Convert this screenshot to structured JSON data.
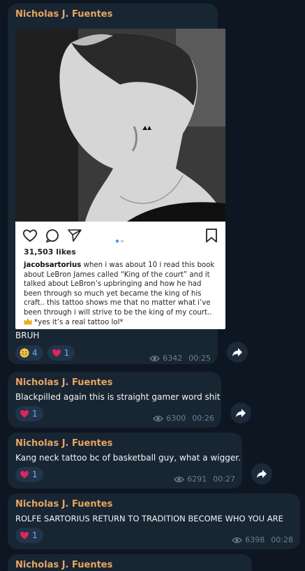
{
  "messages": [
    {
      "sender": "Nicholas J. Fuentes",
      "instagram": {
        "likes": "31,503 likes",
        "caption_user": "jacobsartorius",
        "caption_text": " when i was about 10 i read this book about LeBron James called “King of the court” and it talked about LeBron’s upbringing and how he had been through so much yet became the king of his craft.. this tattoo shows me that no matter what i’ve been through i will strive to be the king of my court..",
        "caption_tail": "*yes it’s a real tattoo lol*"
      },
      "text": "BRUH",
      "reactions": [
        {
          "emoji": "grinning-face",
          "count": "4"
        },
        {
          "emoji": "red-heart",
          "count": "1"
        }
      ],
      "views": "6342",
      "time": "00:25"
    },
    {
      "sender": "Nicholas J. Fuentes",
      "text": "Blackpilled again this is straight gamer word shit",
      "reactions": [
        {
          "emoji": "red-heart",
          "count": "1"
        }
      ],
      "views": "6300",
      "time": "00:26"
    },
    {
      "sender": "Nicholas J. Fuentes",
      "text": "Kang neck tattoo bc of basketball guy, what a wigger.",
      "reactions": [
        {
          "emoji": "red-heart",
          "count": "1"
        }
      ],
      "views": "6291",
      "time": "00:27"
    },
    {
      "sender": "Nicholas J. Fuentes",
      "text": "ROLFE SARTORIUS RETURN TO TRADITION BECOME WHO YOU ARE",
      "reactions": [
        {
          "emoji": "red-heart",
          "count": "1"
        }
      ],
      "views": "6398",
      "time": "00:28"
    },
    {
      "sender": "Nicholas J. Fuentes"
    }
  ],
  "colors": {
    "background": "#0e1621",
    "bubble": "#182533",
    "sender": "#e8a561",
    "reaction_bg": "#213449",
    "reaction_count": "#6ab3f3",
    "meta": "#6d7f8f"
  }
}
